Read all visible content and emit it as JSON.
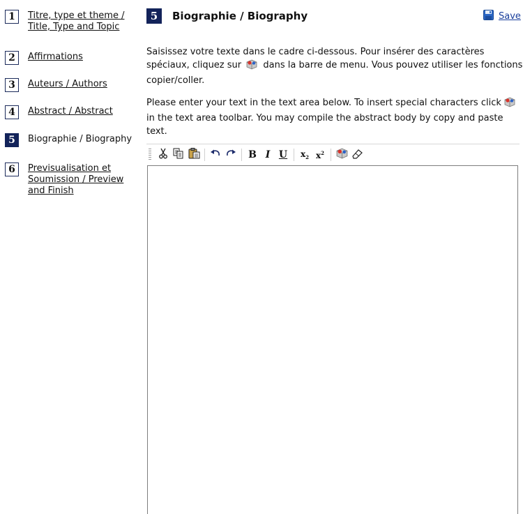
{
  "steps": [
    {
      "number": "1",
      "label": "Titre, type et theme / Title, Type and Topic",
      "active": false
    },
    {
      "number": "2",
      "label": "Affirmations",
      "active": false
    },
    {
      "number": "3",
      "label": "Auteurs / Authors",
      "active": false
    },
    {
      "number": "4",
      "label": "Abstract / Abstract",
      "active": false
    },
    {
      "number": "5",
      "label": "Biographie / Biography",
      "active": true
    },
    {
      "number": "6",
      "label": "Previsualisation et Soumission / Preview and Finish",
      "active": false
    }
  ],
  "heading": {
    "number": "5",
    "title": "Biographie / Biography"
  },
  "save": {
    "label": "Save",
    "icon": "floppy-disk-icon"
  },
  "instructions": {
    "fr_before": "Saisissez votre texte dans le cadre ci-dessous. Pour insérer des caractères spéciaux, cliquez sur",
    "fr_after": "dans la barre de menu. Vous pouvez utiliser les fonctions copier/coller.",
    "en_after": "in the text area toolbar. You may compile the abstract body by copy and paste text.",
    "en_before": "Please enter your text in the text area below. To insert special characters click"
  },
  "toolbar": {
    "bold": "B",
    "italic": "I",
    "underline": "U",
    "subscript_base": "x",
    "subscript_mark": "2",
    "superscript_base": "x",
    "superscript_mark": "2",
    "icons": [
      "cut-icon",
      "copy-icon",
      "paste-icon",
      "undo-icon",
      "redo-icon",
      "bold-icon",
      "italic-icon",
      "underline-icon",
      "subscript-icon",
      "superscript-icon",
      "special-characters-icon",
      "eraser-icon"
    ]
  },
  "editor": {
    "value": ""
  },
  "colors": {
    "accent": "#13235a",
    "link": "#1a3f9c",
    "save_icon": "#2a66c4"
  }
}
